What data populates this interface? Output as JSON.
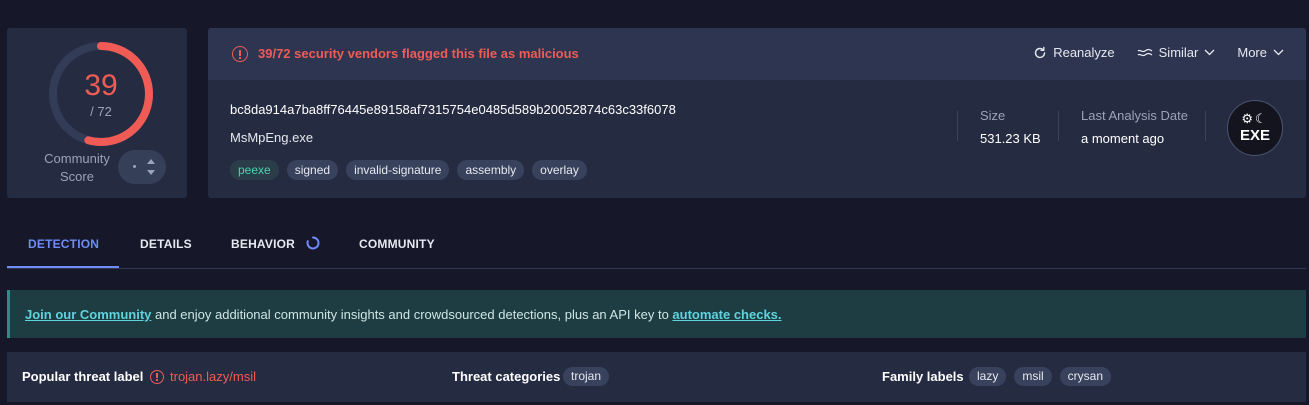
{
  "score": {
    "detected": "39",
    "total": "/ 72",
    "detected_fraction": 0.5417,
    "community_label_line1": "Community",
    "community_label_line2": "Score",
    "gauge_color": "#f05c55"
  },
  "alert": {
    "icon": "alert-circle-icon",
    "text": "39/72 security vendors flagged this file as malicious"
  },
  "actions": {
    "reanalyze": "Reanalyze",
    "similar": "Similar",
    "more": "More"
  },
  "file": {
    "hash": "bc8da914a7ba8ff76445e89158af7315754e0485d589b20052874c63c33f6078",
    "name": "MsMpEng.exe",
    "tags": [
      "peexe",
      "signed",
      "invalid-signature",
      "assembly",
      "overlay"
    ],
    "size_label": "Size",
    "size_value": "531.23 KB",
    "last_analysis_label": "Last Analysis Date",
    "last_analysis_value": "a moment ago",
    "type_badge": "EXE"
  },
  "tabs": [
    "DETECTION",
    "DETAILS",
    "BEHAVIOR",
    "COMMUNITY"
  ],
  "active_tab": "DETECTION",
  "banner": {
    "link1": "Join our Community",
    "middle": " and enjoy additional community insights and crowdsourced detections, plus an API key to ",
    "link2": "automate checks."
  },
  "threat": {
    "popular_label": "Popular threat label",
    "popular_value": "trojan.lazy/msil",
    "categories_label": "Threat categories",
    "categories": [
      "trojan"
    ],
    "family_label": "Family labels",
    "families": [
      "lazy",
      "msil",
      "crysan"
    ]
  },
  "colors": {
    "accent": "#6f8bf8",
    "danger": "#f05c55",
    "teal": "#47d6ae"
  }
}
